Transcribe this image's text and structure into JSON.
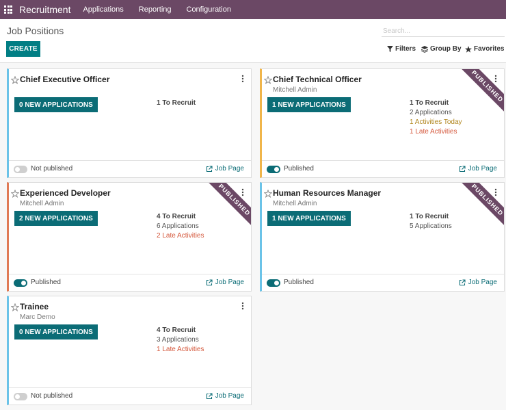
{
  "navbar": {
    "brand": "Recruitment",
    "menu": [
      "Applications",
      "Reporting",
      "Configuration"
    ]
  },
  "control": {
    "title": "Job Positions",
    "create_label": "CREATE",
    "search_placeholder": "Search...",
    "filters_label": "Filters",
    "groupby_label": "Group By",
    "favorites_label": "Favorites"
  },
  "colors": {
    "navbar": "#6b4865",
    "primary": "#0b6c76",
    "late": "#d4573b",
    "today": "#b0851b"
  },
  "job_link_label": "Job Page",
  "jobs": [
    {
      "name": "Chief Executive Officer",
      "manager": "",
      "button": "0 NEW APPLICATIONS",
      "to_recruit": "1 To Recruit",
      "applications": "",
      "activities_today": "",
      "late_activities": "",
      "published": false,
      "published_label": "Not published",
      "ribbon": "",
      "accent": "#6bc3e8"
    },
    {
      "name": "Chief Technical Officer",
      "manager": "Mitchell Admin",
      "button": "1 NEW APPLICATIONS",
      "to_recruit": "1 To Recruit",
      "applications": "2 Applications",
      "activities_today": "1 Activities Today",
      "late_activities": "1 Late Activities",
      "published": true,
      "published_label": "Published",
      "ribbon": "PUBLISHED",
      "accent": "#f0b54a"
    },
    {
      "name": "Experienced Developer",
      "manager": "Mitchell Admin",
      "button": "2 NEW APPLICATIONS",
      "to_recruit": "4 To Recruit",
      "applications": "6 Applications",
      "activities_today": "",
      "late_activities": "2 Late Activities",
      "published": true,
      "published_label": "Published",
      "ribbon": "PUBLISHED",
      "accent": "#e07a55"
    },
    {
      "name": "Human Resources Manager",
      "manager": "Mitchell Admin",
      "button": "1 NEW APPLICATIONS",
      "to_recruit": "1 To Recruit",
      "applications": "5 Applications",
      "activities_today": "",
      "late_activities": "",
      "published": true,
      "published_label": "Published",
      "ribbon": "PUBLISHED",
      "accent": "#6bc3e8"
    },
    {
      "name": "Trainee",
      "manager": "Marc Demo",
      "button": "0 NEW APPLICATIONS",
      "to_recruit": "4 To Recruit",
      "applications": "3 Applications",
      "activities_today": "",
      "late_activities": "1 Late Activities",
      "published": false,
      "published_label": "Not published",
      "ribbon": "",
      "accent": "#6bc3e8"
    }
  ]
}
